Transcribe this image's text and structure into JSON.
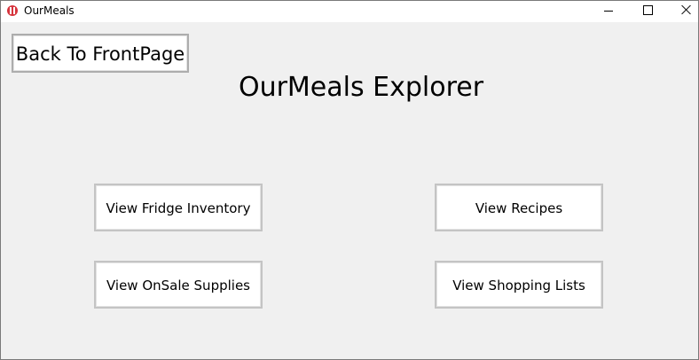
{
  "window": {
    "title": "OurMeals",
    "icon": "app-logo-icon"
  },
  "controls": {
    "minimize_icon": "minimize-icon",
    "maximize_icon": "maximize-icon",
    "close_icon": "close-icon"
  },
  "toolbar": {
    "back_label": "Back To FrontPage"
  },
  "main": {
    "heading": "OurMeals Explorer",
    "buttons": {
      "fridge": "View Fridge Inventory",
      "recipes": "View Recipes",
      "onsale": "View OnSale Supplies",
      "shopping": "View Shopping Lists"
    }
  }
}
